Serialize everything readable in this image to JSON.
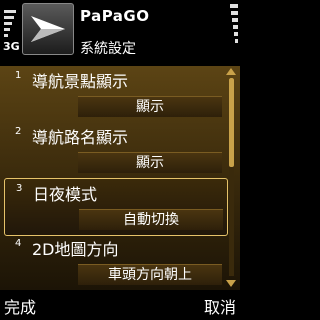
{
  "status": {
    "network": "3G",
    "signal_level": 0.7,
    "battery_level": 0.9
  },
  "header": {
    "app_name": "PaPaGO",
    "title": "系統設定",
    "icon": "papago-arrow-icon"
  },
  "settings": [
    {
      "index": "1",
      "label": "導航景點顯示",
      "value": "顯示"
    },
    {
      "index": "2",
      "label": "導航路名顯示",
      "value": "顯示"
    },
    {
      "index": "3",
      "label": "日夜模式",
      "value": "自動切換",
      "selected": true
    },
    {
      "index": "4",
      "label": "2D地圖方向",
      "value": "車頭方向朝上"
    }
  ],
  "scrollbar": {
    "position": 0.0,
    "visible_fraction": 0.45
  },
  "softkeys": {
    "left": "完成",
    "right": "取消"
  },
  "colors": {
    "accent": "#e6c36a",
    "list_bg": "#5c4414"
  }
}
